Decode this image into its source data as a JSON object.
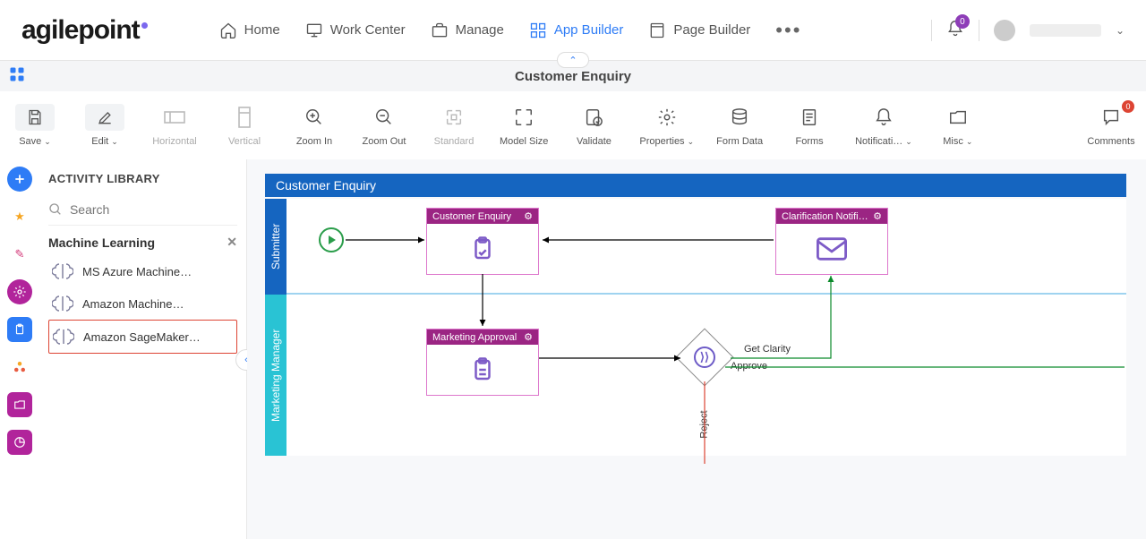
{
  "nav": {
    "home": "Home",
    "work_center": "Work Center",
    "manage": "Manage",
    "app_builder": "App Builder",
    "page_builder": "Page Builder"
  },
  "notifications_count": "0",
  "titlebar": {
    "app_name": "Customer Enquiry"
  },
  "toolbar": {
    "save": "Save",
    "edit": "Edit",
    "horizontal": "Horizontal",
    "vertical": "Vertical",
    "zoom_in": "Zoom In",
    "zoom_out": "Zoom Out",
    "standard": "Standard",
    "model_size": "Model Size",
    "validate": "Validate",
    "properties": "Properties",
    "form_data": "Form Data",
    "forms": "Forms",
    "notifications": "Notificati…",
    "misc": "Misc",
    "comments": "Comments",
    "comments_count": "0"
  },
  "panel": {
    "title": "ACTIVITY LIBRARY",
    "search_placeholder": "Search",
    "category": "Machine Learning",
    "items": [
      "MS Azure Machine…",
      "Amazon Machine…",
      "Amazon SageMaker…"
    ]
  },
  "process": {
    "name": "Customer Enquiry",
    "lanes": [
      "Submitter",
      "Marketing Manager"
    ],
    "activities": {
      "a1": "Customer Enquiry",
      "a2": "Clarification Notifi…",
      "a3": "Marketing Approval"
    },
    "edges": {
      "get_clarity": "Get Clarity",
      "approve": "Approve",
      "reject": "Reject"
    }
  }
}
